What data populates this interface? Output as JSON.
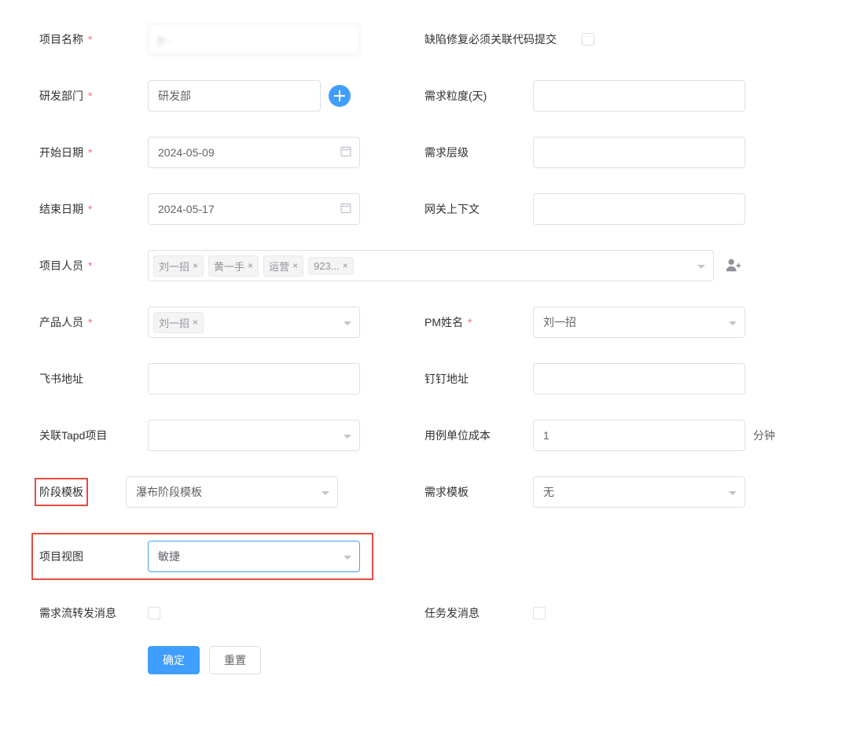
{
  "labels": {
    "project_name": "项目名称",
    "bug_fix_link": "缺陷修复必须关联代码提交",
    "dev_dept": "研发部门",
    "req_granularity": "需求粒度(天)",
    "start_date": "开始日期",
    "req_level": "需求层级",
    "end_date": "结束日期",
    "gateway_context": "网关上下文",
    "project_members": "项目人员",
    "product_members": "产品人员",
    "pm_name": "PM姓名",
    "feishu_url": "飞书地址",
    "dingtalk_url": "钉钉地址",
    "tapd_project": "关联Tapd项目",
    "case_unit_cost": "用例单位成本",
    "unit_minutes": "分钟",
    "stage_template": "阶段模板",
    "req_template": "需求模板",
    "project_view": "项目视图",
    "req_flow_msg": "需求流转发消息",
    "task_msg": "任务发消息",
    "confirm": "确定",
    "reset": "重置"
  },
  "values": {
    "project_name": "p...",
    "dev_dept": "研发部",
    "start_date": "2024-05-09",
    "end_date": "2024-05-17",
    "pm_name": "刘一招",
    "case_unit_cost": "1",
    "stage_template": "瀑布阶段模板",
    "req_template": "无",
    "project_view": "敏捷"
  },
  "tags": {
    "members": [
      {
        "label": "刘一招"
      },
      {
        "label": "黄一手"
      },
      {
        "label": "运营"
      },
      {
        "label": "923..."
      }
    ],
    "product": [
      {
        "label": "刘一招"
      }
    ]
  }
}
